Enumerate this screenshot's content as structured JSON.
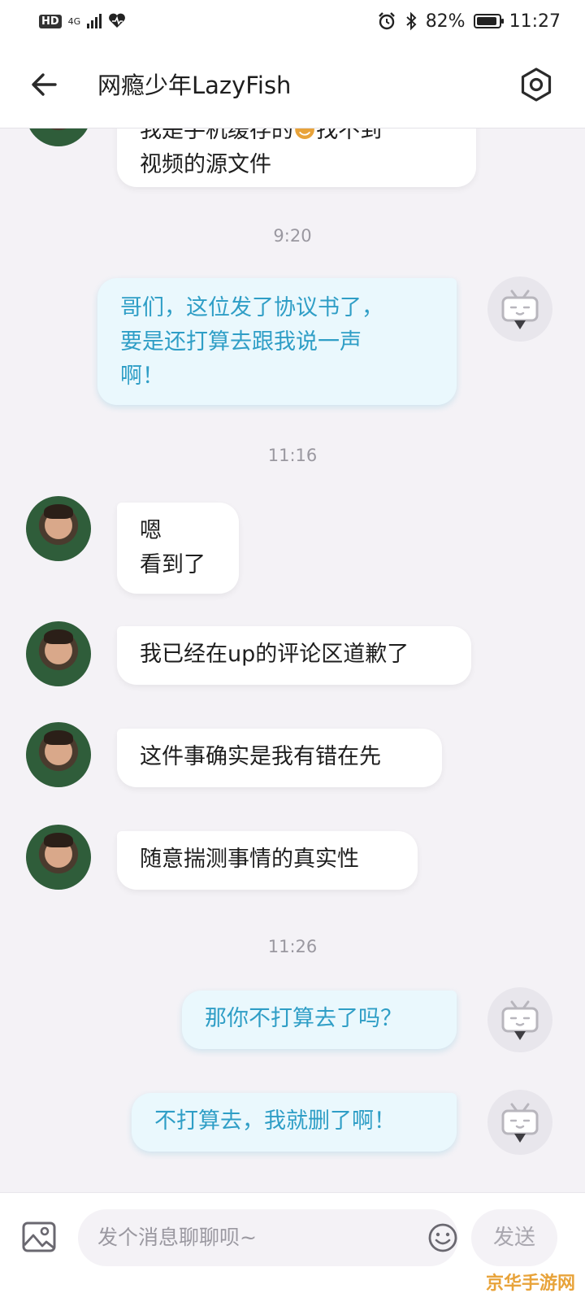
{
  "status_bar": {
    "hd": "HD",
    "network": "4G",
    "battery": "82%",
    "time": "11:27"
  },
  "header": {
    "title": "网瘾少年LazyFish"
  },
  "messages": [
    {
      "from": "other",
      "text": "我是手机缓存的… 找不到视频的源文件"
    },
    {
      "type": "time",
      "text": "9:20"
    },
    {
      "from": "self",
      "text": "哥们，这位发了协议书了，要是还打算去跟我说一声啊！"
    },
    {
      "type": "time",
      "text": "11:16"
    },
    {
      "from": "other",
      "text": "嗯\n看到了"
    },
    {
      "from": "other",
      "text": "我已经在up的评论区道歉了"
    },
    {
      "from": "other",
      "text": "这件事确实是我有错在先"
    },
    {
      "from": "other",
      "text": "随意揣测事情的真实性"
    },
    {
      "type": "time",
      "text": "11:26"
    },
    {
      "from": "self",
      "text": "那你不打算去了吗？"
    },
    {
      "from": "self",
      "text": "不打算去，我就删了啊！"
    }
  ],
  "chat": {
    "m0_line1": "我是手机缓存的",
    "m0_line1b": "找不到",
    "m0_line2": "视频的源文件",
    "t1": "9:20",
    "m1_line1": "哥们，这位发了协议书了，",
    "m1_line2": "要是还打算去跟我说一声",
    "m1_line3": "啊！",
    "t2": "11:16",
    "m2_line1": "嗯",
    "m2_line2": "看到了",
    "m3": "我已经在up的评论区道歉了",
    "m4": "这件事确实是我有错在先",
    "m5": "随意揣测事情的真实性",
    "t3": "11:26",
    "m6": "那你不打算去了吗？",
    "m7": "不打算去，我就删了啊！"
  },
  "input": {
    "placeholder": "发个消息聊聊呗~",
    "send_label": "发送"
  },
  "watermark": "京华手游网",
  "colors": {
    "accent_text": "#2f9ec6",
    "self_bubble": "#eaf8fd",
    "background": "#f4f2f6"
  }
}
